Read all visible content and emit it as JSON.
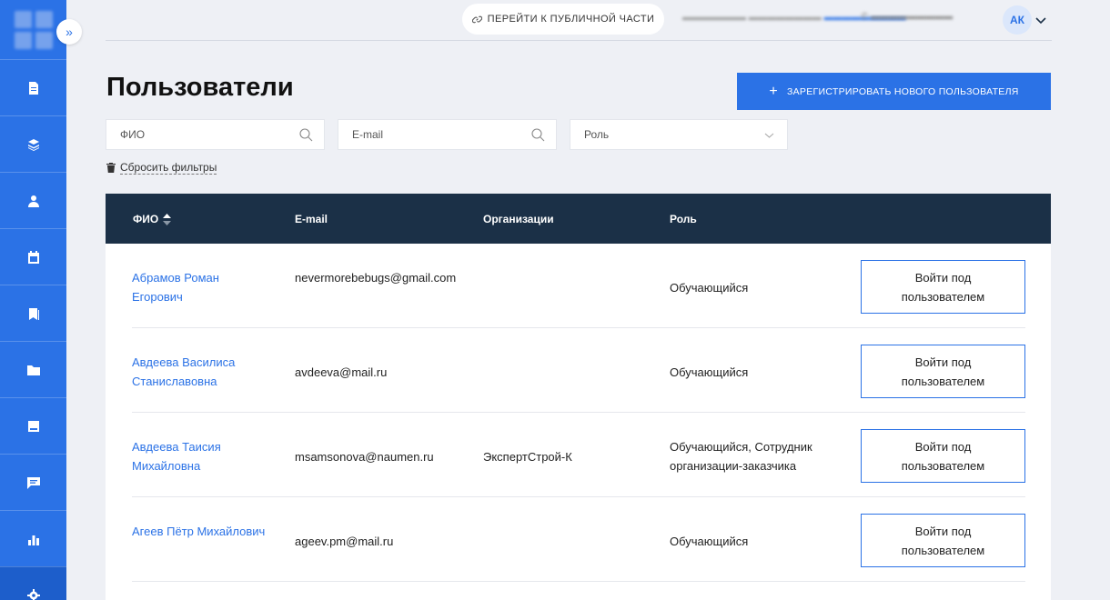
{
  "colors": {
    "accent": "#2b72e6",
    "sidebar": "#2b72e6",
    "table_header": "#1b3047",
    "background": "#eef0f5"
  },
  "sidebar": {
    "toggle_icon": "chevron-double-right-icon",
    "items": [
      {
        "icon": "document-icon"
      },
      {
        "icon": "layers-icon"
      },
      {
        "icon": "user-icon"
      },
      {
        "icon": "calendar-icon"
      },
      {
        "icon": "bookmark-icon"
      },
      {
        "icon": "folder-icon"
      },
      {
        "icon": "book-icon"
      },
      {
        "icon": "chat-icon"
      },
      {
        "icon": "bar-chart-icon"
      },
      {
        "icon": "gear-icon"
      }
    ]
  },
  "topbar": {
    "public_link": "ПЕРЕЙТИ К ПУБЛИЧНОЙ ЧАСТИ",
    "avatar_initials": "АК"
  },
  "page": {
    "title": "Пользователи",
    "register_button": "ЗАРЕГИСТРИРОВАТЬ НОВОГО ПОЛЬЗОВАТЕЛЯ"
  },
  "filters": {
    "fio_placeholder": "ФИО",
    "email_placeholder": "E-mail",
    "role_placeholder": "Роль",
    "reset_label": "Сбросить фильтры"
  },
  "table": {
    "columns": [
      "ФИО",
      "E-mail",
      "Организации",
      "Роль"
    ],
    "rows": [
      {
        "name": "Абрамов Роман Егорович",
        "email": "nevermorebebugs@gmail.com",
        "org": "",
        "role": "Обучающийся",
        "action": "Войти под пользователем"
      },
      {
        "name": "Авдеева Василиса Станиславовна",
        "email": "avdeeva@mail.ru",
        "org": "",
        "role": "Обучающийся",
        "action": "Войти под пользователем"
      },
      {
        "name": "Авдеева Таисия Михайловна",
        "email": "msamsonova@naumen.ru",
        "org": "ЭкспертСтрой-К",
        "role": "Обучающийся, Сотрудник организации-заказчика",
        "action": "Войти под пользователем"
      },
      {
        "name": "Агеев Пётр Михайлович",
        "email": "ageev.pm@mail.ru",
        "org": "",
        "role": "Обучающийся",
        "action": "Войти под пользователем"
      }
    ]
  }
}
